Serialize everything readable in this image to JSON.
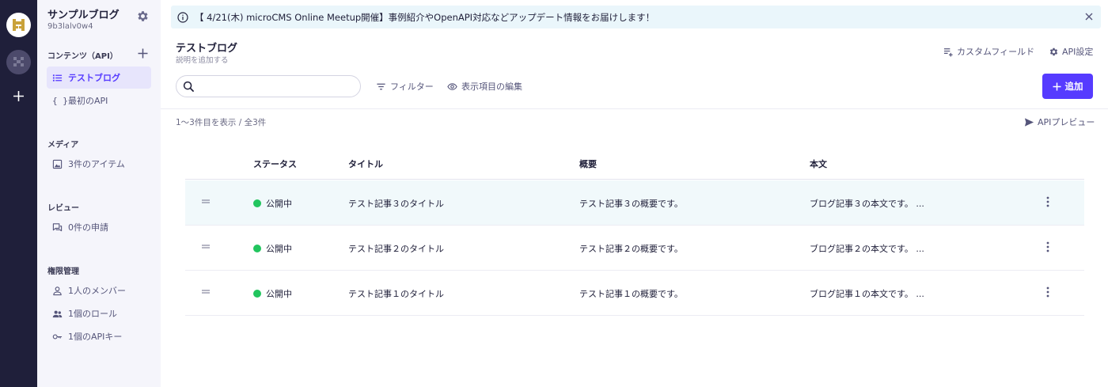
{
  "banner": {
    "text": "【 4/21(木) microCMS Online Meetup開催】事例紹介やOpenAPI対応などアップデート情報をお届けします！"
  },
  "service": {
    "name": "サンプルブログ",
    "id": "9b3lalv0w4"
  },
  "sidebar": {
    "content_heading": "コンテンツ（API）",
    "content_items": [
      {
        "label": "テストブログ"
      },
      {
        "label": "最初のAPI"
      }
    ],
    "media_heading": "メディア",
    "media_item": "3件のアイテム",
    "review_heading": "レビュー",
    "review_item": "0件の申請",
    "perm_heading": "権限管理",
    "perm_items": [
      {
        "label": "1人のメンバー"
      },
      {
        "label": "1個のロール"
      },
      {
        "label": "1個のAPIキー"
      }
    ]
  },
  "page": {
    "title": "テストブログ",
    "description": "説明を追加する",
    "custom_field": "カスタムフィールド",
    "api_settings": "API設定"
  },
  "toolbar": {
    "search_placeholder": "",
    "filter": "フィルター",
    "edit_columns": "表示項目の編集",
    "add": "追加"
  },
  "list": {
    "count_text": "1〜3件目を表示 / 全3件",
    "api_preview": "APIプレビュー",
    "columns": {
      "status": "ステータス",
      "title": "タイトル",
      "summary": "概要",
      "body": "本文"
    },
    "rows": [
      {
        "status": "公開中",
        "title": "テスト記事３のタイトル",
        "summary": "テスト記事３の概要です。",
        "body": "ブログ記事３の本文です。 ..."
      },
      {
        "status": "公開中",
        "title": "テスト記事２のタイトル",
        "summary": "テスト記事２の概要です。",
        "body": "ブログ記事２の本文です。 ..."
      },
      {
        "status": "公開中",
        "title": "テスト記事１のタイトル",
        "summary": "テスト記事１の概要です。",
        "body": "ブログ記事１の本文です。 ..."
      }
    ]
  },
  "colors": {
    "accent": "#563bff",
    "rail": "#1f1f3a",
    "sidebar_bg": "#f5f5fb",
    "banner_bg": "#eaf6fb",
    "status_published": "#22c55e"
  }
}
